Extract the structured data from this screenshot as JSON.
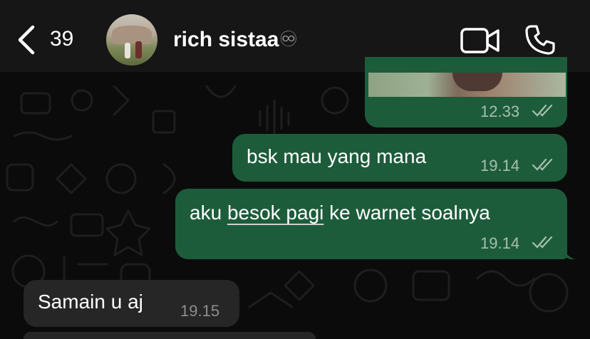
{
  "header": {
    "unread_count": "39",
    "contact_name": "rich sistaa",
    "contact_suffix": "♾"
  },
  "messages": [
    {
      "direction": "outgoing",
      "type": "photo",
      "time": "12.33",
      "status": "read"
    },
    {
      "direction": "outgoing",
      "text": "bsk mau yang mana",
      "time": "19.14",
      "status": "read"
    },
    {
      "direction": "outgoing",
      "text_parts": [
        "aku ",
        "besok pagi",
        " ke warnet soalnya"
      ],
      "time": "19.14",
      "status": "read"
    },
    {
      "direction": "incoming",
      "text": "Samain u aj",
      "time": "19.15"
    }
  ],
  "colors": {
    "outgoing_bubble": "#1d5c3b",
    "incoming_bubble": "#262626",
    "header_bg": "#161616",
    "background": "#0b0b0b"
  },
  "icons": [
    "back-chevron-icon",
    "video-call-icon",
    "phone-icon",
    "read-receipt-icon"
  ]
}
